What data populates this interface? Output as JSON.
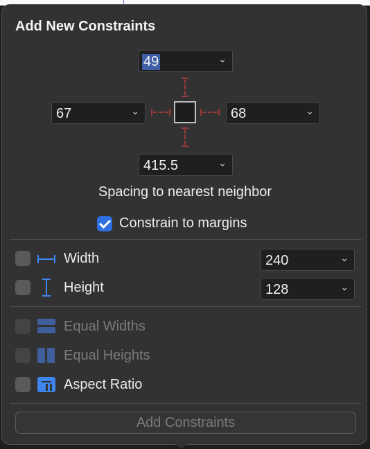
{
  "title": "Add New Constraints",
  "spacing": {
    "top": "49",
    "left": "67",
    "right": "68",
    "bottom": "415.5",
    "caption": "Spacing to nearest neighbor"
  },
  "constrain_margins": {
    "label": "Constrain to margins",
    "checked": true
  },
  "size": {
    "width": {
      "label": "Width",
      "value": "240",
      "checked": false
    },
    "height": {
      "label": "Height",
      "value": "128",
      "checked": false
    }
  },
  "equal": {
    "widths": {
      "label": "Equal Widths",
      "enabled": false
    },
    "heights": {
      "label": "Equal Heights",
      "enabled": false
    },
    "aspect": {
      "label": "Aspect Ratio",
      "enabled": true
    }
  },
  "add_button": "Add Constraints",
  "chevron": "⌄",
  "colors": {
    "accent": "#2f6fe0",
    "strut": "#9a3a3a",
    "icon_blue": "#3d86f0"
  },
  "icons": [
    "chevron-down-icon",
    "width-icon",
    "height-icon",
    "equal-widths-icon",
    "equal-heights-icon",
    "aspect-ratio-icon",
    "checkmark-icon"
  ]
}
